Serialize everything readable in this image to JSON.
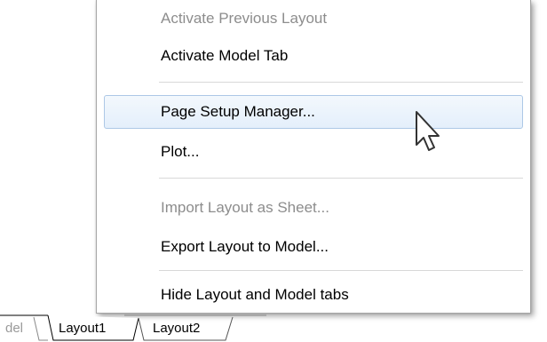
{
  "context_menu": {
    "items": [
      {
        "label": "Activate Previous Layout",
        "enabled": false
      },
      {
        "label": "Activate Model Tab",
        "enabled": true
      },
      {
        "label": "Page Setup Manager...",
        "enabled": true,
        "highlighted": true
      },
      {
        "label": "Plot...",
        "enabled": true
      },
      {
        "label": "Import Layout as Sheet...",
        "enabled": false
      },
      {
        "label": "Export Layout to Model...",
        "enabled": true
      },
      {
        "label": "Hide Layout and Model tabs",
        "enabled": true
      }
    ]
  },
  "layout_tabs": {
    "tabs": [
      {
        "label": "del",
        "active": false,
        "clipped": true
      },
      {
        "label": "Layout1",
        "active": true
      },
      {
        "label": "Layout2",
        "active": false
      }
    ]
  },
  "colors": {
    "highlight_bg": "#e4effb",
    "highlight_border": "#adc8e6",
    "disabled_text": "#8d8d8d"
  }
}
